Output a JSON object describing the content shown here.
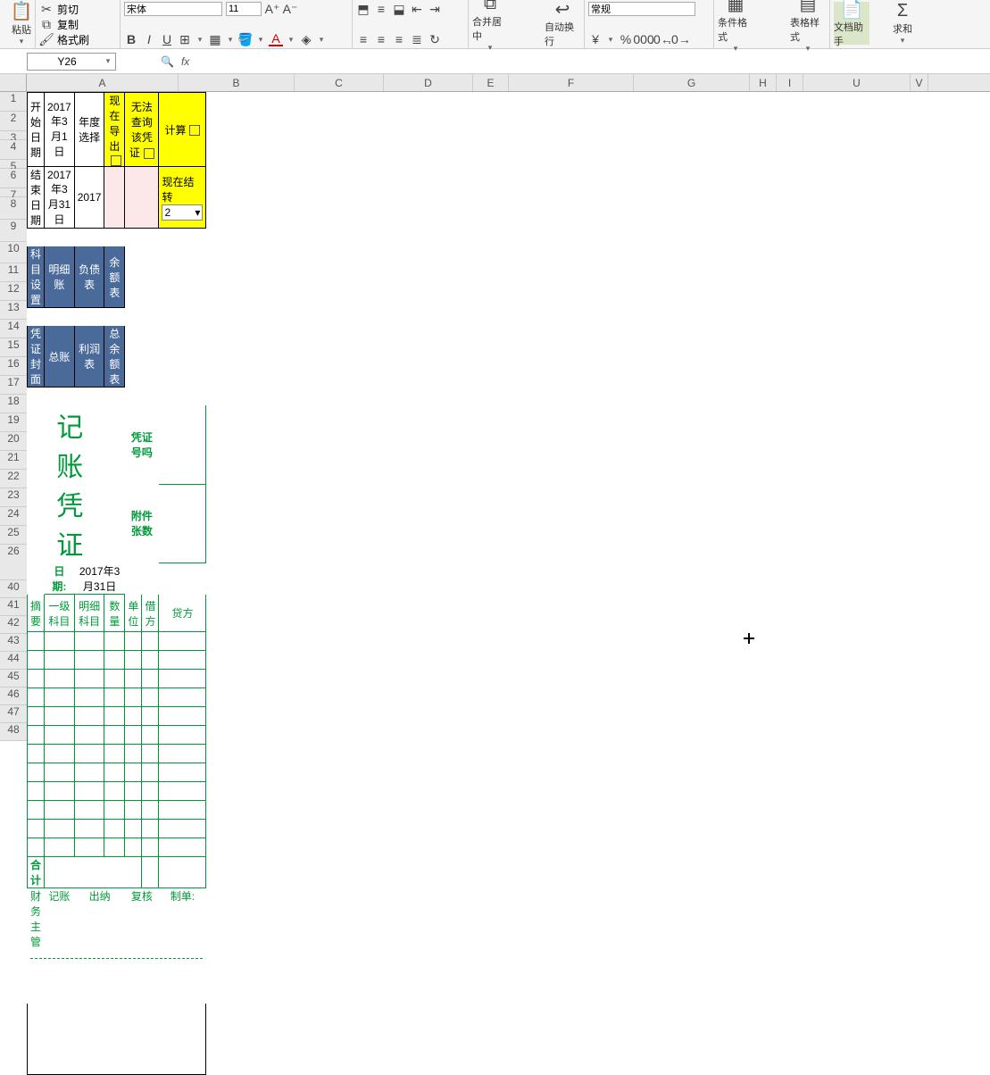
{
  "ribbon": {
    "clipboard": {
      "paste": "粘贴",
      "cut": "剪切",
      "copy": "复制",
      "painter": "格式刷"
    },
    "font": {
      "family": "宋体",
      "size": "11"
    },
    "align": {
      "merge": "合并居中",
      "wrap": "自动换行"
    },
    "number": {
      "format": "常规"
    },
    "styles": {
      "cond": "条件格式",
      "tstyle": "表格样式"
    },
    "doc": {
      "helper": "文档助手",
      "sum": "求和"
    }
  },
  "namebox": "Y26",
  "cols": [
    "A",
    "B",
    "C",
    "D",
    "E",
    "F",
    "G",
    "H",
    "I",
    "U",
    "V"
  ],
  "rows_top": [
    "1",
    "2",
    "3",
    "4",
    "5",
    "6",
    "7",
    "8",
    "9",
    "10",
    "11",
    "12",
    "13",
    "14",
    "15",
    "16",
    "17",
    "18",
    "19",
    "20",
    "21",
    "22",
    "23",
    "24",
    "25",
    "26"
  ],
  "rows_bottom": [
    "40",
    "41",
    "42",
    "43",
    "44",
    "45",
    "46",
    "47",
    "48"
  ],
  "r1": {
    "a": "开始日期",
    "b": "2017年3月1日",
    "c": "年度选择",
    "d": "现在导出",
    "f": "无法查询该凭证",
    "g": "计算"
  },
  "r2": {
    "a": "结束日期",
    "b": "2017年3月31日",
    "c": "2017",
    "g": "现在结转",
    "gval": "2"
  },
  "r4": {
    "a": "科目设置",
    "b": "明细账",
    "c": "负债表",
    "d": "余额表"
  },
  "r5": {
    "a": "凭证封面",
    "b": "总账",
    "c": "利润表",
    "d": "总余额表"
  },
  "title": "记 账 凭 证",
  "voucher_no_label": "凭证号吗",
  "attach_label": "附件张数",
  "date_label": "日期:",
  "date_value": "2017年3月31日",
  "thead": {
    "a": "摘要",
    "b": "一级科目",
    "c": "明细科目",
    "d": "数量",
    "e": "单位",
    "f": "借方",
    "g": "贷方"
  },
  "total_label": "合  计",
  "sig": {
    "a": "财务主管",
    "b": "记账",
    "c": "出纳",
    "f": "复核",
    "g": "制单:"
  }
}
